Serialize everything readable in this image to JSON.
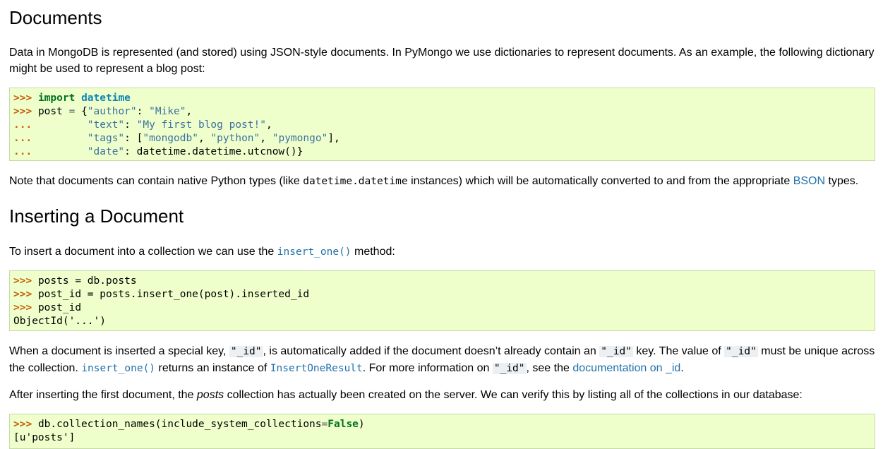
{
  "section1": {
    "title": "Documents",
    "intro": "Data in MongoDB is represented (and stored) using JSON-style documents. In PyMongo we use dictionaries to represent documents. As an example, the following dictionary might be used to represent a blog post:",
    "code": {
      "prompt": ">>>",
      "cont": "...",
      "import_kw": "import",
      "module": "datetime",
      "post_var": "post",
      "eq": "=",
      "brace_open": "{",
      "k_author": "\"author\"",
      "v_author": "\"Mike\"",
      "k_text": "\"text\"",
      "v_text": "\"My first blog post!\"",
      "k_tags": "\"tags\"",
      "v_tag1": "\"mongodb\"",
      "v_tag2": "\"python\"",
      "v_tag3": "\"pymongo\"",
      "k_date": "\"date\"",
      "v_date": "datetime.datetime.utcnow()"
    },
    "note_pre": "Note that documents can contain native Python types (like ",
    "note_code": "datetime.datetime",
    "note_mid": " instances) which will be automatically converted to and from the appropriate ",
    "note_link": "BSON",
    "note_post": " types."
  },
  "section2": {
    "title": "Inserting a Document",
    "intro_pre": "To insert a document into a collection we can use the ",
    "intro_link": "insert_one()",
    "intro_post": " method:",
    "code_lines": [
      "posts = db.posts",
      "post_id = posts.insert_one(post).inserted_id",
      "post_id",
      "ObjectId('...')"
    ],
    "when": {
      "t1": "When a document is inserted a special key, ",
      "c1": "\"_id\"",
      "t2": ", is automatically added if the document doesn’t already contain an ",
      "c2": "\"_id\"",
      "t3": " key. The value of ",
      "c3": "\"_id\"",
      "t4": " must be unique across the collection. ",
      "l1": "insert_one()",
      "t5": " returns an instance of ",
      "l2": "InsertOneResult",
      "t6": ". For more information on ",
      "c4": "\"_id\"",
      "t7": ", see the ",
      "l3": "documentation on _id",
      "t8": "."
    },
    "after": {
      "t1": "After inserting the first document, the ",
      "em": "posts",
      "t2": " collection has actually been created on the server. We can verify this by listing all of the collections in our database:"
    },
    "code3": {
      "call": "db.collection_names(include_system_collections",
      "kw": "False",
      "close": ")",
      "result": "[u'posts']"
    }
  },
  "colors": {
    "code_bg": "#eeffcc",
    "link": "#2171a8",
    "prompt": "#c65d09",
    "keyword": "#007020",
    "string": "#4070a0"
  }
}
